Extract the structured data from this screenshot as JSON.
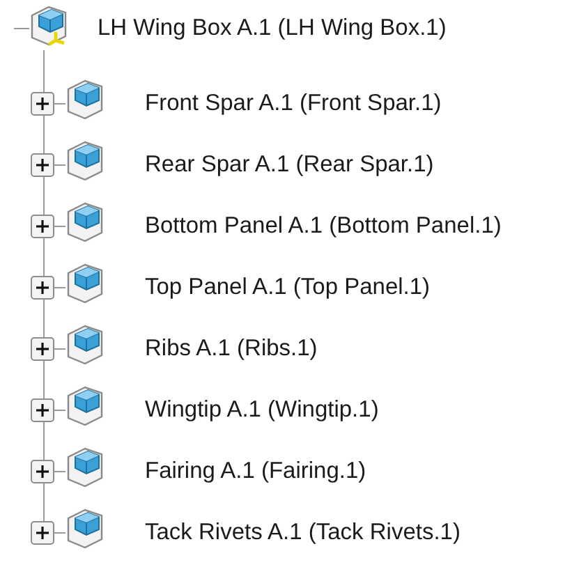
{
  "tree": {
    "label": "LH Wing Box A.1 (LH Wing Box.1)",
    "expanded": true,
    "children": [
      {
        "label": "Front Spar A.1 (Front Spar.1)",
        "expanded": false
      },
      {
        "label": "Rear Spar A.1 (Rear Spar.1)",
        "expanded": false
      },
      {
        "label": "Bottom Panel A.1 (Bottom Panel.1)",
        "expanded": false
      },
      {
        "label": "Top Panel A.1 (Top Panel.1)",
        "expanded": false
      },
      {
        "label": "Ribs A.1 (Ribs.1)",
        "expanded": false
      },
      {
        "label": "Wingtip A.1 (Wingtip.1)",
        "expanded": false
      },
      {
        "label": "Fairing A.1 (Fairing.1)",
        "expanded": false
      },
      {
        "label": "Tack Rivets A.1 (Tack Rivets.1)",
        "expanded": false
      }
    ]
  }
}
